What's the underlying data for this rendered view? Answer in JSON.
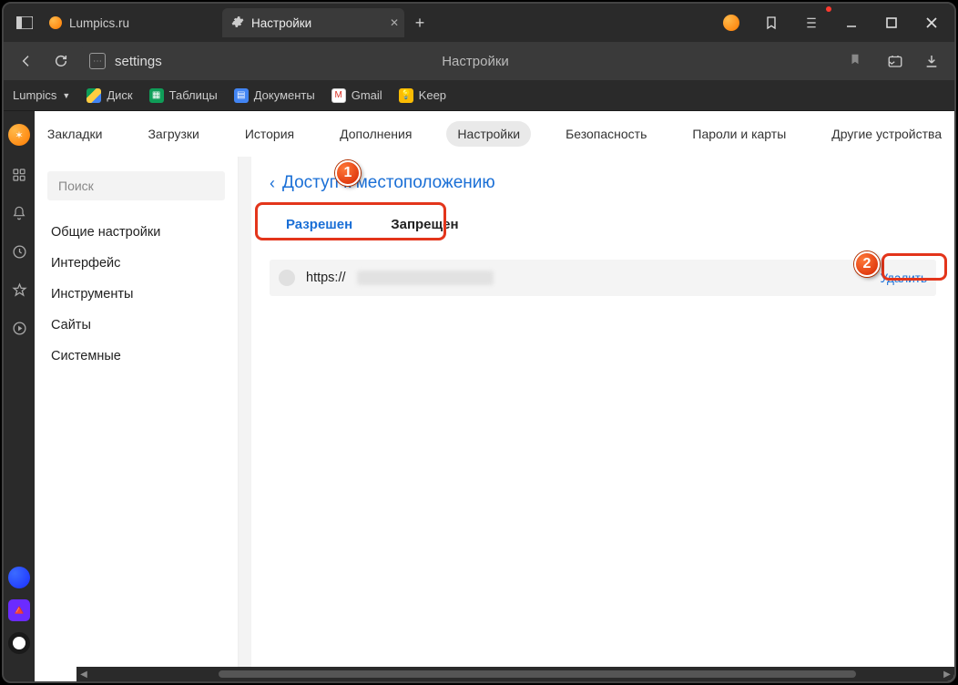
{
  "titlebar": {
    "tab_inactive": "Lumpics.ru",
    "tab_active": "Настройки"
  },
  "addrbar": {
    "url_text": "settings",
    "center_title": "Настройки"
  },
  "bookmarks": {
    "site": "Lumpics",
    "items": [
      "Диск",
      "Таблицы",
      "Документы",
      "Gmail",
      "Keep"
    ]
  },
  "page_tabs": [
    "Закладки",
    "Загрузки",
    "История",
    "Дополнения",
    "Настройки",
    "Безопасность",
    "Пароли и карты",
    "Другие устройства"
  ],
  "sidebar": {
    "search_placeholder": "Поиск",
    "links": [
      "Общие настройки",
      "Интерфейс",
      "Инструменты",
      "Сайты",
      "Системные"
    ]
  },
  "main": {
    "breadcrumb": "Доступ к местоположению",
    "perm_tabs": {
      "allowed": "Разрешен",
      "denied": "Запрещен"
    },
    "site_url_prefix": "https://",
    "delete_label": "Удалить"
  },
  "badges": {
    "one": "1",
    "two": "2"
  }
}
